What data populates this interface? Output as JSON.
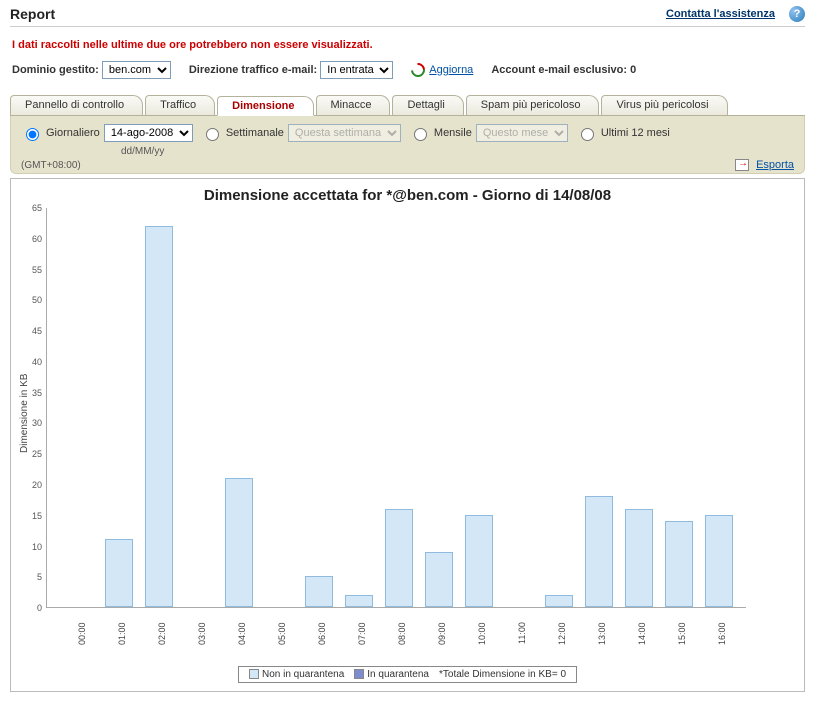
{
  "header": {
    "title": "Report",
    "support_link": "Contatta l'assistenza"
  },
  "warning": "I dati raccolti nelle ultime due ore potrebbero non essere visualizzati.",
  "filters": {
    "domain_label": "Dominio gestito:",
    "domain_value": "ben.com",
    "direction_label": "Direzione traffico e-mail:",
    "direction_value": "In entrata",
    "refresh_label": "Aggiorna",
    "exclusive_label": "Account e-mail esclusivo: 0"
  },
  "tabs": [
    "Pannello di controllo",
    "Traffico",
    "Dimensione",
    "Minacce",
    "Dettagli",
    "Spam più pericoloso",
    "Virus più pericolosi"
  ],
  "active_tab": "Dimensione",
  "time_filter": {
    "daily_label": "Giornaliero",
    "daily_value": "14-ago-2008",
    "daily_hint": "dd/MM/yy",
    "weekly_label": "Settimanale",
    "weekly_placeholder": "Questa settimana",
    "monthly_label": "Mensile",
    "monthly_placeholder": "Questo mese",
    "yearly_label": "Ultimi 12 mesi",
    "timezone": "(GMT+08:00)",
    "export_label": "Esporta"
  },
  "chart_data": {
    "type": "bar",
    "title": "Dimensione accettata for *@ben.com - Giorno di 14/08/08",
    "ylabel": "Dimensione in KB",
    "xlabel": "",
    "ylim": [
      0,
      65
    ],
    "yticks": [
      0,
      5,
      10,
      15,
      20,
      25,
      30,
      35,
      40,
      45,
      50,
      55,
      60,
      65
    ],
    "categories": [
      "00:00",
      "01:00",
      "02:00",
      "03:00",
      "04:00",
      "05:00",
      "06:00",
      "07:00",
      "08:00",
      "09:00",
      "10:00",
      "11:00",
      "12:00",
      "13:00",
      "14:00",
      "15:00",
      "16:00"
    ],
    "series": [
      {
        "name": "Non in quarantena",
        "values": [
          0,
          11,
          62,
          0,
          21,
          0,
          5,
          2,
          16,
          9,
          15,
          0,
          2,
          18,
          16,
          14,
          15
        ]
      },
      {
        "name": "In quarantena",
        "values": [
          0,
          0,
          0,
          0,
          0,
          0,
          0,
          0,
          0,
          0,
          0,
          0,
          0,
          0,
          0,
          0,
          0
        ]
      }
    ],
    "legend_note": "*Totale Dimensione in KB= 0"
  }
}
